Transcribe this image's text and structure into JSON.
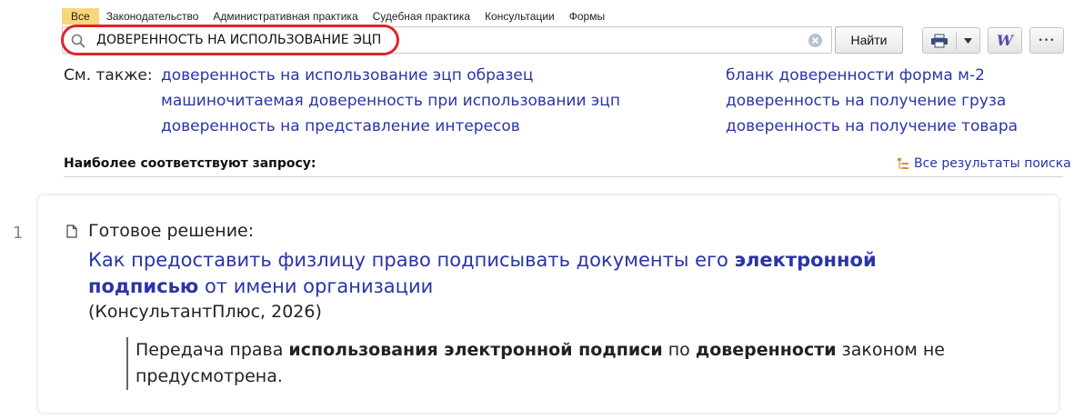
{
  "tabs": [
    "Все",
    "Законодательство",
    "Административная практика",
    "Судебная практика",
    "Консультации",
    "Формы"
  ],
  "search": {
    "query": "ДОВЕРЕННОСТЬ НА ИСПОЛЬЗОВАНИЕ ЭЦП",
    "button_label": "Найти",
    "icon": "search-icon",
    "clear_icon": "clear-icon",
    "highlight_color": "#e0232b"
  },
  "toolbar": {
    "print_icon": "print-icon",
    "dropdown_icon": "chevron-down-icon",
    "word_label": "W",
    "more_label": "•••"
  },
  "see_also": {
    "label": "См. также:",
    "left_links": [
      "доверенность на использование эцп образец",
      "машиночитаемая доверенность при использовании эцп",
      "доверенность на представление интересов"
    ],
    "right_links": [
      "бланк доверенности форма м-2",
      "доверенность на получение груза",
      "доверенность на получение товара"
    ]
  },
  "results_header": {
    "title": "Наиболее соответствуют запросу:",
    "all_results": "Все результаты поиска"
  },
  "result": {
    "number": "1",
    "type": "Готовое решение:",
    "title_parts": {
      "t1": "Как предоставить физлицу право подписывать документы его ",
      "b1": "электронной подписью",
      "t2": " от имени организации"
    },
    "source": "(КонсультантПлюс, 2026)",
    "snippet_parts": {
      "s1": "Передача права ",
      "b1": "использования электронной подписи",
      "s2": " по ",
      "b2": "доверенности",
      "s3": " законом не предусмотрена."
    }
  },
  "colors": {
    "link": "#2a34a8",
    "active_tab": "#f6d77a",
    "accent_orange": "#e08a2b"
  }
}
